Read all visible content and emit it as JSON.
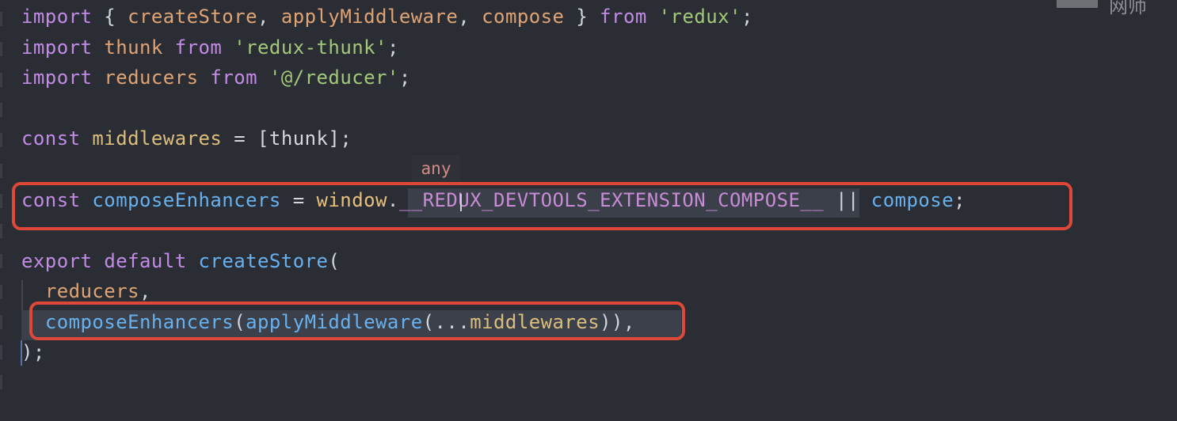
{
  "editor": {
    "lines": [
      [
        {
          "text": "import",
          "class": "kw"
        },
        {
          "text": " { ",
          "class": "tkn-punc"
        },
        {
          "text": "createStore",
          "class": "tkn-id"
        },
        {
          "text": ", ",
          "class": "tkn-punc"
        },
        {
          "text": "applyMiddleware",
          "class": "tkn-id"
        },
        {
          "text": ", ",
          "class": "tkn-punc"
        },
        {
          "text": "compose",
          "class": "tkn-id"
        },
        {
          "text": " } ",
          "class": "tkn-punc"
        },
        {
          "text": "from",
          "class": "kw"
        },
        {
          "text": " ",
          "class": "tkn-punc"
        },
        {
          "text": "'redux'",
          "class": "tkn-str"
        },
        {
          "text": ";",
          "class": "tkn-punc"
        }
      ],
      [
        {
          "text": "import",
          "class": "kw"
        },
        {
          "text": " ",
          "class": "tkn-punc"
        },
        {
          "text": "thunk",
          "class": "tkn-id"
        },
        {
          "text": " ",
          "class": "tkn-punc"
        },
        {
          "text": "from",
          "class": "kw"
        },
        {
          "text": " ",
          "class": "tkn-punc"
        },
        {
          "text": "'redux-thunk'",
          "class": "tkn-str"
        },
        {
          "text": ";",
          "class": "tkn-punc"
        }
      ],
      [
        {
          "text": "import",
          "class": "kw"
        },
        {
          "text": " ",
          "class": "tkn-punc"
        },
        {
          "text": "reducers",
          "class": "tkn-id"
        },
        {
          "text": " ",
          "class": "tkn-punc"
        },
        {
          "text": "from",
          "class": "kw"
        },
        {
          "text": " ",
          "class": "tkn-punc"
        },
        {
          "text": "'@/reducer'",
          "class": "tkn-str"
        },
        {
          "text": ";",
          "class": "tkn-punc"
        }
      ],
      [],
      [
        {
          "text": "const",
          "class": "kw"
        },
        {
          "text": " ",
          "class": "tkn-punc"
        },
        {
          "text": "middlewares",
          "class": "tkn-mid"
        },
        {
          "text": " = ",
          "class": "tkn-op"
        },
        {
          "text": "[thunk]",
          "class": "tkn-op"
        },
        {
          "text": ";",
          "class": "tkn-punc"
        }
      ],
      [],
      [
        {
          "text": "const",
          "class": "kw"
        },
        {
          "text": " ",
          "class": "tkn-punc"
        },
        {
          "text": "composeEnhancers",
          "class": "tkn-fn"
        },
        {
          "text": " = ",
          "class": "tkn-op"
        },
        {
          "text": "window",
          "class": "tkn-cur"
        },
        {
          "text": ".",
          "class": "tkn-op"
        },
        {
          "text": "__REDUX_DEVTOOLS_EXTENSION_COMPOSE__",
          "class": "tkn-redux"
        },
        {
          "text": " || ",
          "class": "tkn-op"
        },
        {
          "text": "compose",
          "class": "tkn-fn"
        },
        {
          "text": ";",
          "class": "tkn-punc"
        }
      ],
      [],
      [
        {
          "text": "export",
          "class": "kw"
        },
        {
          "text": " ",
          "class": "tkn-punc"
        },
        {
          "text": "default",
          "class": "kw"
        },
        {
          "text": " ",
          "class": "tkn-punc"
        },
        {
          "text": "createStore",
          "class": "tkn-fn"
        },
        {
          "text": "(",
          "class": "tkn-punc"
        }
      ],
      [
        {
          "text": "  ",
          "class": "tkn-punc"
        },
        {
          "text": "reducers",
          "class": "tkn-id"
        },
        {
          "text": ",",
          "class": "tkn-punc"
        }
      ],
      [
        {
          "text": "  ",
          "class": "tkn-punc"
        },
        {
          "text": "composeEnhancers",
          "class": "tkn-fn"
        },
        {
          "text": "(",
          "class": "tkn-punc"
        },
        {
          "text": "applyMiddleware",
          "class": "tkn-fn"
        },
        {
          "text": "(",
          "class": "tkn-punc"
        },
        {
          "text": "...",
          "class": "tkn-op"
        },
        {
          "text": "middlewares",
          "class": "tkn-mid"
        },
        {
          "text": ")),",
          "class": "tkn-punc"
        }
      ],
      [
        {
          "text": ");",
          "class": "tkn-punc"
        }
      ]
    ],
    "hint": "any"
  },
  "corner": {
    "text": "网师"
  }
}
